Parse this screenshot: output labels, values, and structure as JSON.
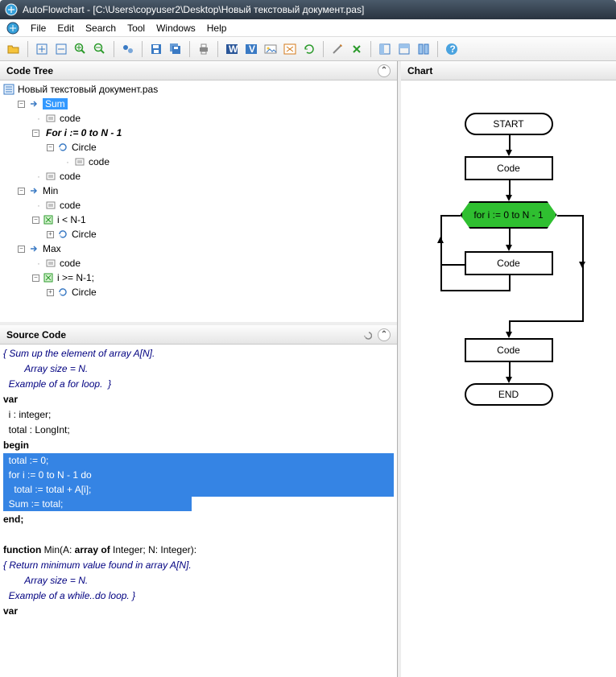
{
  "title": "AutoFlowchart - [C:\\Users\\copyuser2\\Desktop\\Новый текстовый документ.pas]",
  "menus": [
    "File",
    "Edit",
    "Search",
    "Tool",
    "Windows",
    "Help"
  ],
  "panels": {
    "codeTree": "Code Tree",
    "sourceCode": "Source Code",
    "chart": "Chart"
  },
  "tree": {
    "root_file": "Новый текстовый документ.pas",
    "items": [
      {
        "depth": 1,
        "toggle": "-",
        "icon": "arrow",
        "label": "Sum",
        "selected": true
      },
      {
        "depth": 2,
        "toggle": "",
        "icon": "code",
        "label": "code"
      },
      {
        "depth": 2,
        "toggle": "-",
        "icon": "",
        "label": "For  i := 0 to N - 1",
        "italic": true
      },
      {
        "depth": 3,
        "toggle": "-",
        "icon": "loop",
        "label": "Circle"
      },
      {
        "depth": 4,
        "toggle": "",
        "icon": "code",
        "label": "code"
      },
      {
        "depth": 2,
        "toggle": "",
        "icon": "code",
        "label": "code"
      },
      {
        "depth": 1,
        "toggle": "-",
        "icon": "arrow",
        "label": "Min"
      },
      {
        "depth": 2,
        "toggle": "",
        "icon": "code",
        "label": "code"
      },
      {
        "depth": 2,
        "toggle": "-",
        "icon": "cond",
        "label": "i < N-1"
      },
      {
        "depth": 3,
        "toggle": "+",
        "icon": "loop",
        "label": "Circle"
      },
      {
        "depth": 1,
        "toggle": "-",
        "icon": "arrow",
        "label": "Max"
      },
      {
        "depth": 2,
        "toggle": "",
        "icon": "code",
        "label": "code"
      },
      {
        "depth": 2,
        "toggle": "-",
        "icon": "cond",
        "label": "i >= N-1;"
      },
      {
        "depth": 3,
        "toggle": "+",
        "icon": "loop",
        "label": "Circle"
      }
    ]
  },
  "source": {
    "l1": "{ Sum up the element of array A[N].",
    "l2": "        Array size = N.",
    "l3": "  Example of a for loop.  }",
    "l4": "var",
    "l5": "  i : integer;",
    "l6": "  total : LongInt;",
    "l7": "begin",
    "l8": "  total := 0;",
    "l9": "  for i := 0 to N - 1 do",
    "l10": "    total := total + A[i];",
    "l11": "",
    "l12": "  Sum := total;",
    "l13": "end;",
    "l14": "",
    "l15": "function Min(A: array of Integer; N: Integer):",
    "l16": "{ Return minimum value found in array A[N].",
    "l17": "        Array size = N.",
    "l18": "  Example of a while..do loop. }",
    "l19": "var"
  },
  "flow": {
    "start": "START",
    "code1": "Code",
    "loop": "for i := 0 to N - 1",
    "code2": "Code",
    "code3": "Code",
    "end": "END"
  },
  "chart_data": {
    "type": "flowchart",
    "nodes": [
      {
        "id": "start",
        "shape": "terminator",
        "label": "START"
      },
      {
        "id": "c1",
        "shape": "process",
        "label": "Code"
      },
      {
        "id": "loop",
        "shape": "loop",
        "label": "for i := 0 to N - 1",
        "highlighted": true
      },
      {
        "id": "c2",
        "shape": "process",
        "label": "Code"
      },
      {
        "id": "c3",
        "shape": "process",
        "label": "Code"
      },
      {
        "id": "end",
        "shape": "terminator",
        "label": "END"
      }
    ],
    "edges": [
      [
        "start",
        "c1"
      ],
      [
        "c1",
        "loop"
      ],
      [
        "loop",
        "c2"
      ],
      [
        "c2",
        "loop"
      ],
      [
        "loop",
        "c3"
      ],
      [
        "c3",
        "end"
      ]
    ]
  }
}
